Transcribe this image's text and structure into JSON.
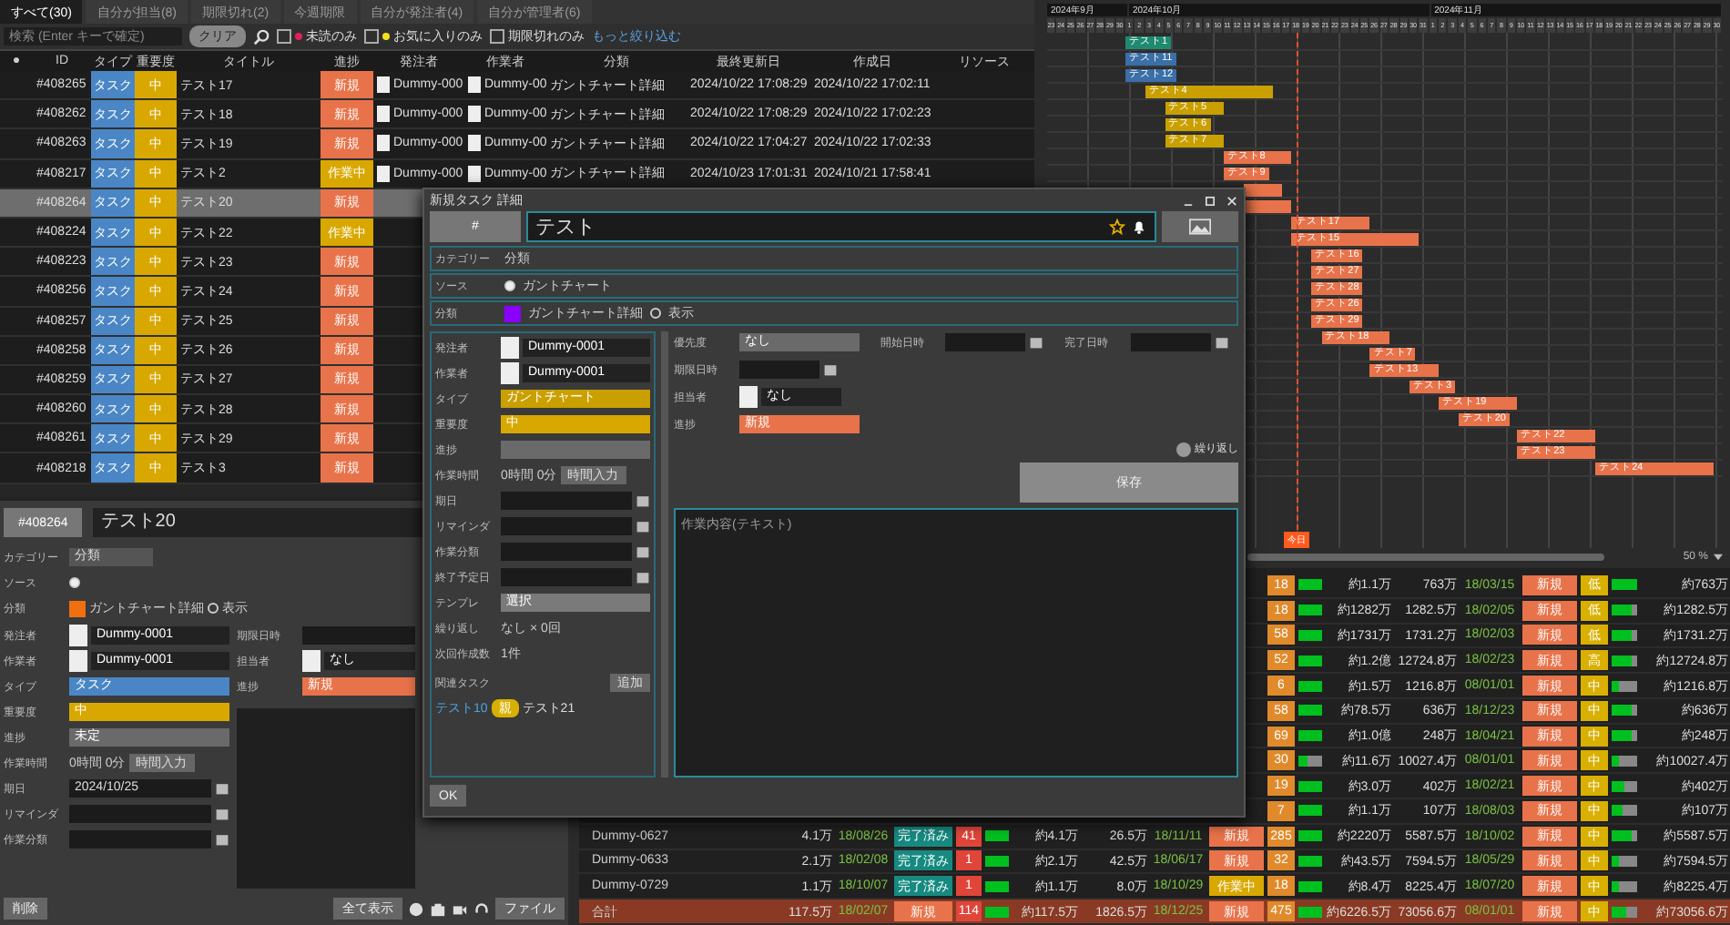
{
  "list_panel": {
    "tabs": [
      {
        "label": "すべて(30)",
        "selected": true
      },
      {
        "label": "自分が担当(8)",
        "selected": false
      },
      {
        "label": "期限切れ(2)",
        "selected": false
      },
      {
        "label": "今週期限",
        "selected": false
      },
      {
        "label": "自分が発注者(4)",
        "selected": false
      },
      {
        "label": "自分が管理者(6)",
        "selected": false
      }
    ],
    "search": {
      "placeholder": "検索 (Enter キーで確定)"
    },
    "clear_button": "クリア",
    "filters": [
      {
        "label": "未読のみ",
        "checked": false,
        "color": "#e0205a"
      },
      {
        "label": "お気に入りのみ",
        "checked": false,
        "color": "#f0e020"
      },
      {
        "label": "期限切れのみ",
        "checked": false
      }
    ],
    "more_link": "もっと絞り込む",
    "columns": [
      "●",
      "ID",
      "タイプ",
      "重要度",
      "タイトル",
      "進捗",
      "発注者",
      "作業者",
      "分類",
      "最終更新日",
      "作成日",
      "リソース"
    ],
    "rows": [
      {
        "id": "#408265",
        "type": "タスク",
        "priority": "中",
        "title": "テスト17",
        "status": {
          "label": "新規",
          "color": "#e8734a"
        },
        "orderer": "Dummy-000",
        "worker": "Dummy-00",
        "category": "ガントチャート詳細",
        "updated": "2024/10/22 17:08:29",
        "created": "2024/10/22 17:02:11",
        "selected": false
      },
      {
        "id": "#408262",
        "type": "タスク",
        "priority": "中",
        "title": "テスト18",
        "status": {
          "label": "新規",
          "color": "#e8734a"
        },
        "orderer": "Dummy-000",
        "worker": "Dummy-00",
        "category": "ガントチャート詳細",
        "updated": "2024/10/22 17:08:29",
        "created": "2024/10/22 17:02:23",
        "selected": false
      },
      {
        "id": "#408263",
        "type": "タスク",
        "priority": "中",
        "title": "テスト19",
        "status": {
          "label": "新規",
          "color": "#e8734a"
        },
        "orderer": "Dummy-000",
        "worker": "Dummy-00",
        "category": "ガントチャート詳細",
        "updated": "2024/10/22 17:04:27",
        "created": "2024/10/22 17:02:33",
        "selected": false
      },
      {
        "id": "#408217",
        "type": "タスク",
        "priority": "中",
        "title": "テスト2",
        "status": {
          "label": "作業中",
          "color": "#d9a800"
        },
        "orderer": "Dummy-000",
        "worker": "Dummy-00",
        "category": "ガントチャート詳細",
        "updated": "2024/10/23 17:01:31",
        "created": "2024/10/21 17:58:41",
        "selected": false
      },
      {
        "id": "#408264",
        "type": "タスク",
        "priority": "中",
        "title": "テスト20",
        "status": {
          "label": "新規",
          "color": "#e8734a"
        },
        "selected": true
      },
      {
        "id": "#408224",
        "type": "タスク",
        "priority": "中",
        "title": "テスト22",
        "status": {
          "label": "作業中",
          "color": "#d9a800"
        },
        "selected": false
      },
      {
        "id": "#408223",
        "type": "タスク",
        "priority": "中",
        "title": "テスト23",
        "status": {
          "label": "新規",
          "color": "#e8734a"
        },
        "selected": false
      },
      {
        "id": "#408256",
        "type": "タスク",
        "priority": "中",
        "title": "テスト24",
        "status": {
          "label": "新規",
          "color": "#e8734a"
        },
        "selected": false
      },
      {
        "id": "#408257",
        "type": "タスク",
        "priority": "中",
        "title": "テスト25",
        "status": {
          "label": "新規",
          "color": "#e8734a"
        },
        "selected": false
      },
      {
        "id": "#408258",
        "type": "タスク",
        "priority": "中",
        "title": "テスト26",
        "status": {
          "label": "新規",
          "color": "#e8734a"
        },
        "selected": false
      },
      {
        "id": "#408259",
        "type": "タスク",
        "priority": "中",
        "title": "テスト27",
        "status": {
          "label": "新規",
          "color": "#e8734a"
        },
        "selected": false
      },
      {
        "id": "#408260",
        "type": "タスク",
        "priority": "中",
        "title": "テスト28",
        "status": {
          "label": "新規",
          "color": "#e8734a"
        },
        "selected": false
      },
      {
        "id": "#408261",
        "type": "タスク",
        "priority": "中",
        "title": "テスト29",
        "status": {
          "label": "新規",
          "color": "#e8734a"
        },
        "selected": false
      },
      {
        "id": "#408218",
        "type": "タスク",
        "priority": "中",
        "title": "テスト3",
        "status": {
          "label": "新規",
          "color": "#e8734a"
        },
        "selected": false
      }
    ]
  },
  "gantt": {
    "months": [
      {
        "label": "2024年9月",
        "days": [
          "23",
          "24",
          "25",
          "26",
          "27",
          "28",
          "29",
          "30"
        ]
      },
      {
        "label": "2024年10月",
        "days": [
          "1",
          "2",
          "3",
          "4",
          "5",
          "6",
          "7",
          "8",
          "9",
          "10",
          "11",
          "12",
          "13",
          "14",
          "15",
          "16",
          "17",
          "18",
          "19",
          "20",
          "21",
          "22",
          "23",
          "24",
          "25",
          "26",
          "27",
          "28",
          "29",
          "30",
          "31"
        ]
      },
      {
        "label": "2024年11月",
        "days": [
          "1",
          "2",
          "3",
          "4",
          "5",
          "6",
          "7",
          "8",
          "9",
          "10",
          "11",
          "12",
          "13",
          "14",
          "15",
          "16",
          "17",
          "18",
          "19",
          "20",
          "21",
          "22",
          "23",
          "24",
          "25",
          "26",
          "27",
          "28",
          "29",
          "30"
        ]
      }
    ],
    "today": {
      "label": "今日"
    },
    "bars": [
      {
        "label": "テスト1",
        "color": "#1f8a70"
      },
      {
        "label": "テスト11",
        "color": "#3a6fa8"
      },
      {
        "label": "テスト12",
        "color": "#3a6fa8"
      },
      {
        "label": "テスト4",
        "color": "#c9a000"
      },
      {
        "label": "テスト5",
        "color": "#c9a000"
      },
      {
        "label": "テスト6",
        "color": "#c9a000"
      },
      {
        "label": "テスト7",
        "color": "#c9a000"
      },
      {
        "label": "テスト8",
        "color": "#e8734a"
      },
      {
        "label": "テスト9",
        "color": "#e8734a"
      },
      {
        "color": "#e8734a"
      },
      {
        "color": "#e8734a"
      },
      {
        "label": "テスト17",
        "color": "#e8734a"
      },
      {
        "label": "テスト15",
        "color": "#e8734a"
      },
      {
        "label": "テスト16",
        "color": "#e8734a"
      },
      {
        "label": "テスト27",
        "color": "#e8734a"
      },
      {
        "label": "テスト28",
        "color": "#e8734a"
      },
      {
        "label": "テスト26",
        "color": "#e8734a"
      },
      {
        "label": "テスト29",
        "color": "#e8734a"
      },
      {
        "label": "テスト18",
        "color": "#e8734a"
      },
      {
        "label": "テスト7",
        "color": "#e8734a"
      },
      {
        "label": "テスト13",
        "color": "#e8734a"
      },
      {
        "label": "テスト3",
        "color": "#e8734a"
      },
      {
        "label": "テスト19",
        "color": "#e8734a"
      },
      {
        "label": "テスト20",
        "color": "#e8734a"
      },
      {
        "label": "テスト22",
        "color": "#e8734a"
      },
      {
        "label": "テスト23",
        "color": "#e8734a"
      },
      {
        "label": "テスト24",
        "color": "#e8734a"
      }
    ],
    "zoom": "50 %"
  },
  "summary_table": {
    "rows": [
      {
        "count2": "18",
        "progress2": {
          "level": 1
        },
        "estimate2": "約1.1万",
        "actual2": "763万",
        "due": "18/03/15",
        "state2": "新規",
        "flag": "低",
        "progress3": {
          "level": 1
        },
        "total": "約763万"
      },
      {
        "count2": "18",
        "progress2": {
          "level": 1
        },
        "estimate2": "約1282万",
        "actual2": "1282.5万",
        "due": "18/02/05",
        "state2": "新規",
        "flag": "低",
        "progress3": {
          "level": 0.8
        },
        "total": "約1282.5万"
      },
      {
        "count2": "58",
        "progress2": {
          "level": 1
        },
        "estimate2": "約1731万",
        "actual2": "1731.2万",
        "due": "18/02/03",
        "state2": "新規",
        "flag": "低",
        "progress3": {
          "level": 0.8
        },
        "total": "約1731.2万"
      },
      {
        "count2": "52",
        "progress2": {
          "level": 1
        },
        "estimate2": "約1.2億",
        "actual2": "12724.8万",
        "due": "18/02/23",
        "state2": "新規",
        "flag": "高",
        "progress3": {
          "level": 0.8
        },
        "total": "約12724.8万"
      },
      {
        "count2": "6",
        "progress2": {
          "level": 1
        },
        "estimate2": "約1.5万",
        "actual2": "1216.8万",
        "due": "08/01/01",
        "state2": "新規",
        "flag": "中",
        "progress3": {
          "level": 0.3
        },
        "total": "約1216.8万"
      },
      {
        "count2": "58",
        "progress2": {
          "level": 1
        },
        "estimate2": "約78.5万",
        "actual2": "636万",
        "due": "18/12/23",
        "state2": "新規",
        "flag": "中",
        "progress3": {
          "level": 0.8
        },
        "total": "約636万"
      },
      {
        "count2": "69",
        "progress2": {
          "level": 1
        },
        "estimate2": "約1.0億",
        "actual2": "248万",
        "due": "18/04/21",
        "state2": "新規",
        "flag": "中",
        "progress3": {
          "level": 0.8
        },
        "total": "約248万"
      },
      {
        "count2": "30",
        "progress2": {
          "level": 0.4
        },
        "estimate2": "約11.6万",
        "actual2": "10027.4万",
        "due": "08/01/01",
        "state2": "新規",
        "flag": "中",
        "progress3": {
          "level": 0.3
        },
        "total": "約10027.4万"
      },
      {
        "count2": "19",
        "progress2": {
          "level": 1
        },
        "estimate2": "約3.0万",
        "actual2": "402万",
        "due": "18/02/21",
        "state2": "新規",
        "flag": "中",
        "progress3": {
          "level": 0.5
        },
        "total": "約402万"
      },
      {
        "count2": "7",
        "progress2": {
          "level": 1
        },
        "estimate2": "約1.1万",
        "actual2": "107万",
        "due": "18/08/03",
        "state2": "新規",
        "flag": "中",
        "progress3": {
          "level": 0.4
        },
        "total": "約107万"
      },
      {
        "name": "Dummy-0627",
        "amount": "4.1万",
        "date": "18/08/26",
        "status": {
          "label": "完了済み",
          "color": "#168a80"
        },
        "count": "41",
        "level": 1,
        "estimate": "約4.1万",
        "actual": "26.5万",
        "date2": "18/11/11",
        "state": {
          "label": "新規",
          "color": "#e8734a"
        },
        "count2": "285",
        "progress2": {
          "level": 1
        },
        "estimate2": "約2220万",
        "actual2": "5587.5万",
        "due": "18/10/02",
        "state2": "新規",
        "flag": "中",
        "progress3": {
          "level": 0.8
        },
        "total": "約5587.5万"
      },
      {
        "name": "Dummy-0633",
        "amount": "2.1万",
        "date": "18/02/08",
        "status": {
          "label": "完了済み",
          "color": "#168a80"
        },
        "count": "1",
        "level": 1,
        "estimate": "約2.1万",
        "actual": "42.5万",
        "date2": "18/06/17",
        "state": {
          "label": "新規",
          "color": "#e8734a"
        },
        "count2": "32",
        "progress2": {
          "level": 1
        },
        "estimate2": "約43.5万",
        "actual2": "7594.5万",
        "due": "18/05/29",
        "state2": "新規",
        "flag": "中",
        "progress3": {
          "level": 0.3
        },
        "total": "約7594.5万"
      },
      {
        "name": "Dummy-0729",
        "amount": "1.1万",
        "date": "18/10/07",
        "status": {
          "label": "完了済み",
          "color": "#168a80"
        },
        "count": "1",
        "level": 1,
        "estimate": "約1.1万",
        "actual": "8.0万",
        "date2": "18/10/29",
        "state": {
          "label": "作業中",
          "color": "#d9a800"
        },
        "count2": "18",
        "progress2": {
          "level": 1
        },
        "estimate2": "約8.4万",
        "actual2": "8225.4万",
        "due": "18/07/20",
        "state2": "新規",
        "flag": "中",
        "progress3": {
          "level": 0.3
        },
        "total": "約8225.4万"
      },
      {
        "kind": "total",
        "name": "合計",
        "amount": "117.5万",
        "date": "18/02/07",
        "status": {
          "label": "新規",
          "color": "#e8734a"
        },
        "count": "114",
        "level": 1,
        "estimate": "約117.5万",
        "actual": "1826.5万",
        "date2": "18/12/25",
        "state": {
          "label": "新規",
          "color": "#e8734a"
        },
        "count2": "475",
        "progress2": {
          "level": 1
        },
        "estimate2": "約6226.5万",
        "actual2": "73056.6万",
        "due": "08/01/01",
        "state2": "新規",
        "flag": "中",
        "progress3": {
          "level": 0.6
        },
        "total": "約73056.6万"
      }
    ]
  },
  "detail": {
    "id_button": "#408264",
    "title": "テスト20",
    "top_rows": [
      {
        "kind": "text",
        "label": "カテゴリー",
        "value": "分類"
      },
      {
        "kind": "radio",
        "label": "ソース",
        "checked": true
      },
      {
        "kind": "color",
        "label": "分類",
        "color": "#f07010",
        "value": "ガントチャート詳細",
        "extra": {
          "label": "表示",
          "checked": false
        }
      }
    ],
    "left_fields": [
      {
        "kind": "person",
        "label": "発注者",
        "value": "Dummy-0001"
      },
      {
        "kind": "person",
        "label": "作業者",
        "value": "Dummy-0001"
      },
      {
        "kind": "select",
        "label": "タイプ",
        "value": "タスク",
        "color": "#4a86c5"
      },
      {
        "kind": "select",
        "label": "重要度",
        "value": "中",
        "color": "#d9a800"
      },
      {
        "kind": "select",
        "label": "進捗",
        "value": "未定",
        "color": "#6a6a6a"
      },
      {
        "kind": "time",
        "label": "作業時間",
        "value": "0時間 0分",
        "button": "時間入力"
      },
      {
        "kind": "date",
        "label": "期日",
        "value": "2024/10/25"
      },
      {
        "kind": "date",
        "label": "リマインダ"
      },
      {
        "kind": "date",
        "label": "作業分類"
      }
    ],
    "right_fields": [
      {
        "kind": "date",
        "label": "期限日時"
      },
      {
        "kind": "person",
        "label": "担当者",
        "value": "なし"
      },
      {
        "kind": "select",
        "label": "進捗",
        "value": "新規",
        "color": "#e8734a"
      }
    ],
    "delete_button": "削除",
    "show_all_button": "全て表示",
    "file_button": "ファイル"
  },
  "dialog": {
    "title": "新規タスク 詳細",
    "hash_button": "#",
    "title_input": "テスト",
    "top_rows": [
      {
        "kind": "text",
        "label": "カテゴリー",
        "value": "分類"
      },
      {
        "kind": "radio",
        "label": "ソース",
        "value": "ガントチャート",
        "checked": true
      },
      {
        "kind": "color",
        "label": "分類",
        "color": "#8a00ff",
        "value": "ガントチャート詳細",
        "extra": {
          "label": "表示",
          "checked": false
        }
      }
    ],
    "left_fields": [
      {
        "kind": "person",
        "label": "発注者",
        "value": "Dummy-0001"
      },
      {
        "kind": "person",
        "label": "作業者",
        "value": "Dummy-0001"
      },
      {
        "kind": "select",
        "label": "タイプ",
        "value": "ガントチャート",
        "color": "#c9a000"
      },
      {
        "kind": "select",
        "label": "重要度",
        "value": "中",
        "color": "#d9a800"
      },
      {
        "kind": "select",
        "label": "進捗",
        "color": "#6a6a6a"
      },
      {
        "kind": "time",
        "label": "作業時間",
        "value": "0時間 0分",
        "button": "時間入力"
      },
      {
        "kind": "date",
        "label": "期日"
      },
      {
        "kind": "date",
        "label": "リマインダ"
      },
      {
        "kind": "date",
        "label": "作業分類"
      },
      {
        "kind": "date",
        "label": "終了予定日"
      },
      {
        "kind": "select",
        "label": "テンプレ",
        "value": "選択",
        "color": "#7a7a7a"
      },
      {
        "kind": "text",
        "label": "繰り返し",
        "value": "なし × 0回"
      },
      {
        "kind": "text",
        "label": "次回作成数",
        "value": "1件"
      }
    ],
    "related": {
      "label": "関連タスク",
      "button": "追加",
      "items": [
        {
          "label": "テスト10",
          "kind": "link"
        },
        {
          "label": "親",
          "kind": "chip"
        },
        {
          "label": "テスト21",
          "kind": "text"
        }
      ]
    },
    "right_fields": [
      {
        "kind": "select",
        "label": "優先度",
        "value": "なし",
        "color": "#6a6a6a"
      },
      {
        "kind": "date",
        "label": "開始日時"
      },
      {
        "kind": "date",
        "label": "完了日時"
      },
      {
        "kind": "date",
        "label": "期限日時"
      },
      {
        "kind": "person",
        "label": "担当者",
        "value": "なし"
      },
      {
        "kind": "select",
        "label": "進捗",
        "value": "新規",
        "color": "#e8734a"
      }
    ],
    "repeat_toggle": {
      "label": "繰り返し",
      "on": false
    },
    "save_button": "保存",
    "memo": {
      "placeholder": "作業内容(テキスト)"
    },
    "ok_button": "OK"
  }
}
